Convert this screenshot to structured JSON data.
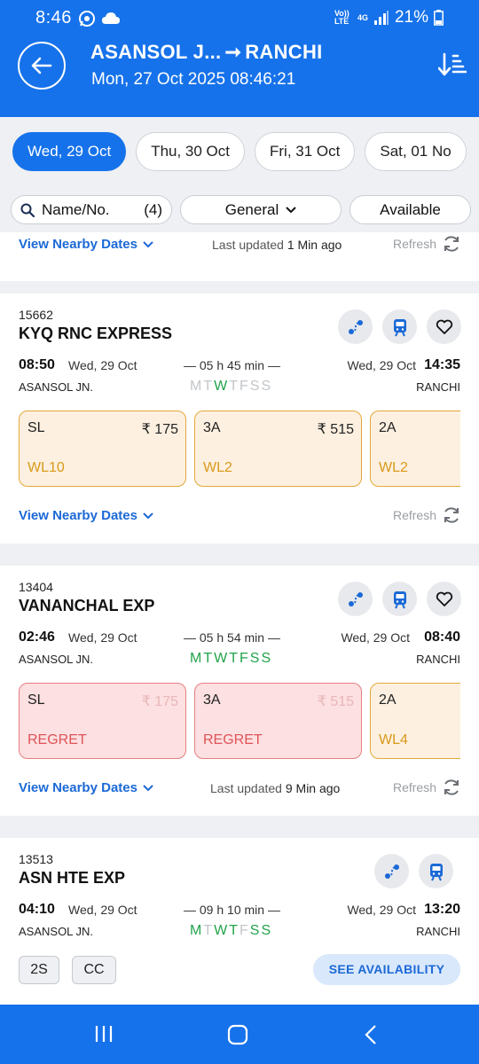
{
  "status_bar": {
    "time": "8:46",
    "network": "4G",
    "battery": "21%",
    "volte": "Vo)) LTE"
  },
  "header": {
    "route_from": "ASANSOL J...",
    "route_to": "RANCHI",
    "datetime": "Mon, 27 Oct 2025 08:46:21",
    "colors": {
      "primary": "#1672ea"
    }
  },
  "dates": [
    {
      "label": "Wed, 29 Oct",
      "active": true
    },
    {
      "label": "Thu, 30 Oct"
    },
    {
      "label": "Fri, 31 Oct"
    },
    {
      "label": "Sat, 01 No"
    }
  ],
  "filters": {
    "search_label": "Name/No.",
    "search_count": "(4)",
    "quota": "General",
    "availability": "Available"
  },
  "strip_top": {
    "nearby": "View Nearby Dates",
    "updated_prefix": "Last updated",
    "updated_value": "1 Min ago",
    "refresh": "Refresh"
  },
  "trains": [
    {
      "number": "15662",
      "name": "KYQ RNC EXPRESS",
      "dep_time": "08:50",
      "dep_date": "Wed, 29 Oct",
      "duration": "05 h 45 min",
      "arr_date": "Wed, 29 Oct",
      "arr_time": "14:35",
      "from": "ASANSOL JN.",
      "to": "RANCHI",
      "days": [
        "M",
        "T",
        "W",
        "T",
        "F",
        "S",
        "S"
      ],
      "days_on": [
        false,
        false,
        true,
        false,
        false,
        false,
        false
      ],
      "classes": [
        {
          "name": "SL",
          "fare": "₹ 175",
          "status": "WL10"
        },
        {
          "name": "3A",
          "fare": "₹ 515",
          "status": "WL2"
        },
        {
          "name": "2A",
          "fare": "",
          "status": "WL2"
        }
      ],
      "nearby": "View Nearby Dates",
      "refresh": "Refresh"
    },
    {
      "number": "13404",
      "name": "VANANCHAL EXP",
      "dep_time": "02:46",
      "dep_date": "Wed, 29 Oct",
      "duration": "05 h 54 min",
      "arr_date": "Wed, 29 Oct",
      "arr_time": "08:40",
      "from": "ASANSOL JN.",
      "to": "RANCHI",
      "days": [
        "M",
        "T",
        "W",
        "T",
        "F",
        "S",
        "S"
      ],
      "days_on": [
        true,
        true,
        true,
        true,
        true,
        true,
        true
      ],
      "classes": [
        {
          "name": "SL",
          "fare": "₹ 175",
          "status": "REGRET"
        },
        {
          "name": "3A",
          "fare": "₹ 515",
          "status": "REGRET"
        },
        {
          "name": "2A",
          "fare": "",
          "status": "WL4"
        }
      ],
      "nearby": "View Nearby Dates",
      "updated_prefix": "Last updated",
      "updated_value": "9 Min ago",
      "refresh": "Refresh"
    },
    {
      "number": "13513",
      "name": "ASN HTE EXP",
      "dep_time": "04:10",
      "dep_date": "Wed, 29 Oct",
      "duration": "09 h 10 min",
      "arr_date": "Wed, 29 Oct",
      "arr_time": "13:20",
      "from": "ASANSOL JN.",
      "to": "RANCHI",
      "days": [
        "M",
        "T",
        "W",
        "T",
        "F",
        "S",
        "S"
      ],
      "days_on": [
        true,
        false,
        true,
        true,
        false,
        true,
        true
      ],
      "quotas": [
        "2S",
        "CC"
      ],
      "see_availability": "SEE AVAILABILITY"
    }
  ],
  "icons": [
    "back-arrow-icon",
    "sort-icon",
    "search-icon",
    "chevron-down-icon",
    "refresh-icon",
    "route-icon",
    "train-icon",
    "heart-icon"
  ]
}
